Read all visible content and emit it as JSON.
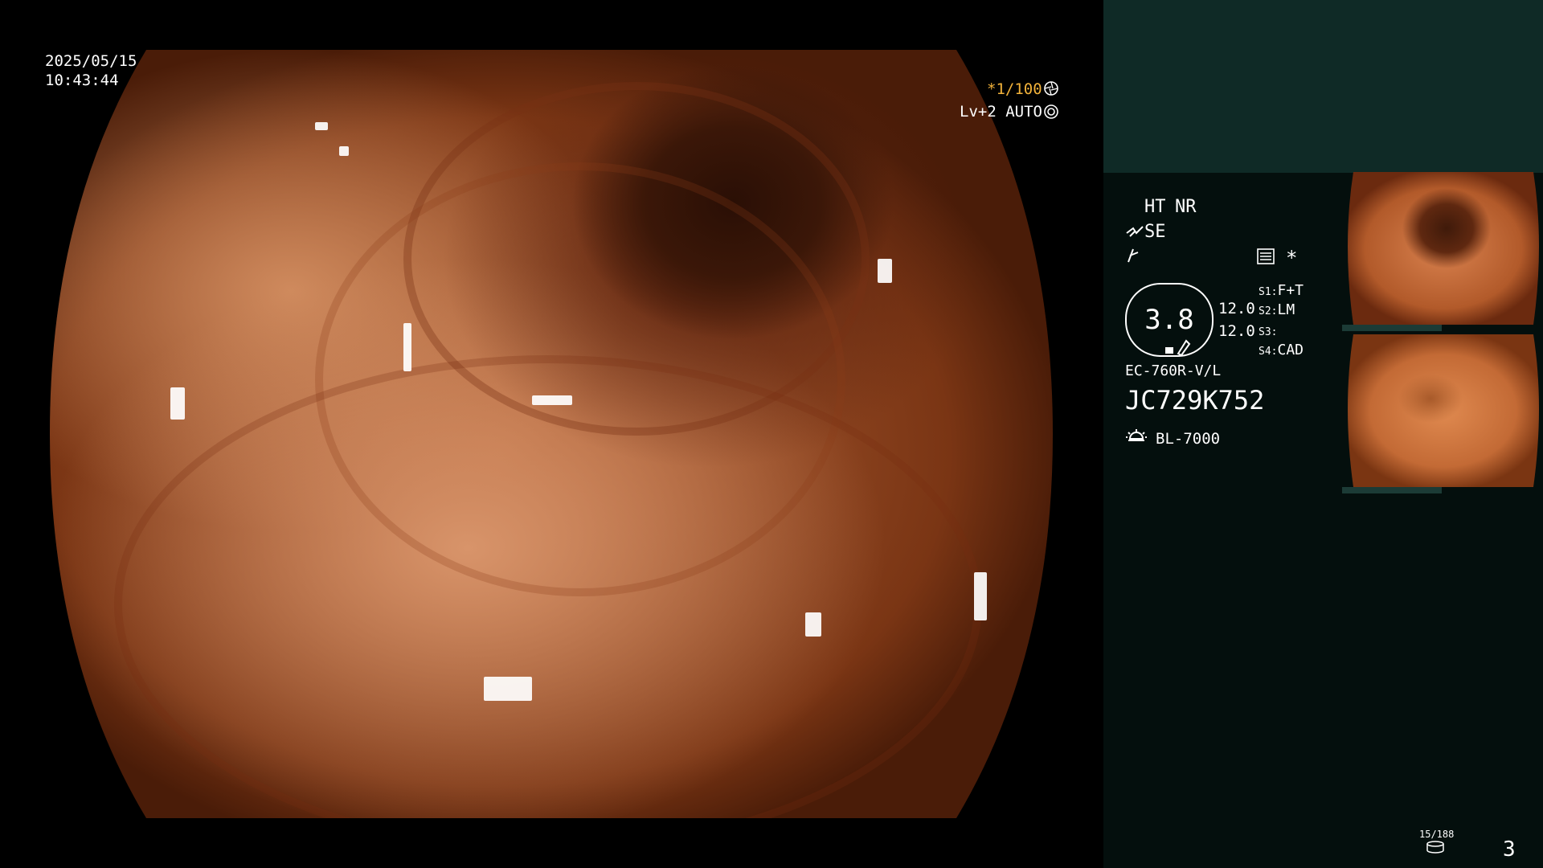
{
  "feed": {
    "date": "2025/05/15",
    "time": "10:43:44",
    "shutter": "*1/100",
    "enhance": "Lv+2 AUTO"
  },
  "panel": {
    "ht": "HT",
    "nr": "NR",
    "se": "SE",
    "asterisk": "*",
    "zoom_value": "3.8",
    "left_values": [
      "12.0",
      "12.0"
    ],
    "slots": [
      {
        "key": "S1:",
        "value": "F+T"
      },
      {
        "key": "S2:",
        "value": "LM"
      },
      {
        "key": "S3:",
        "value": ""
      },
      {
        "key": "S4:",
        "value": "CAD"
      }
    ],
    "scope_model": "EC-760R-V/L",
    "serial": "JC729K752",
    "light_source": "BL-7000",
    "thumb_counter": "15/188",
    "page_number": "3"
  },
  "icons": {
    "shutter_icon": "aperture-icon",
    "auto_icon": "iris-icon",
    "structure_icon": "structure-enhance-icon",
    "color_icon": "color-mode-icon",
    "memo_icon": "memo-icon",
    "light_icon": "lamp-icon",
    "storage_icon": "storage-icon"
  },
  "colors": {
    "accent_yellow": "#f2b23a",
    "panel_top": "#0f2a26",
    "panel_bottom": "#040f0d"
  }
}
